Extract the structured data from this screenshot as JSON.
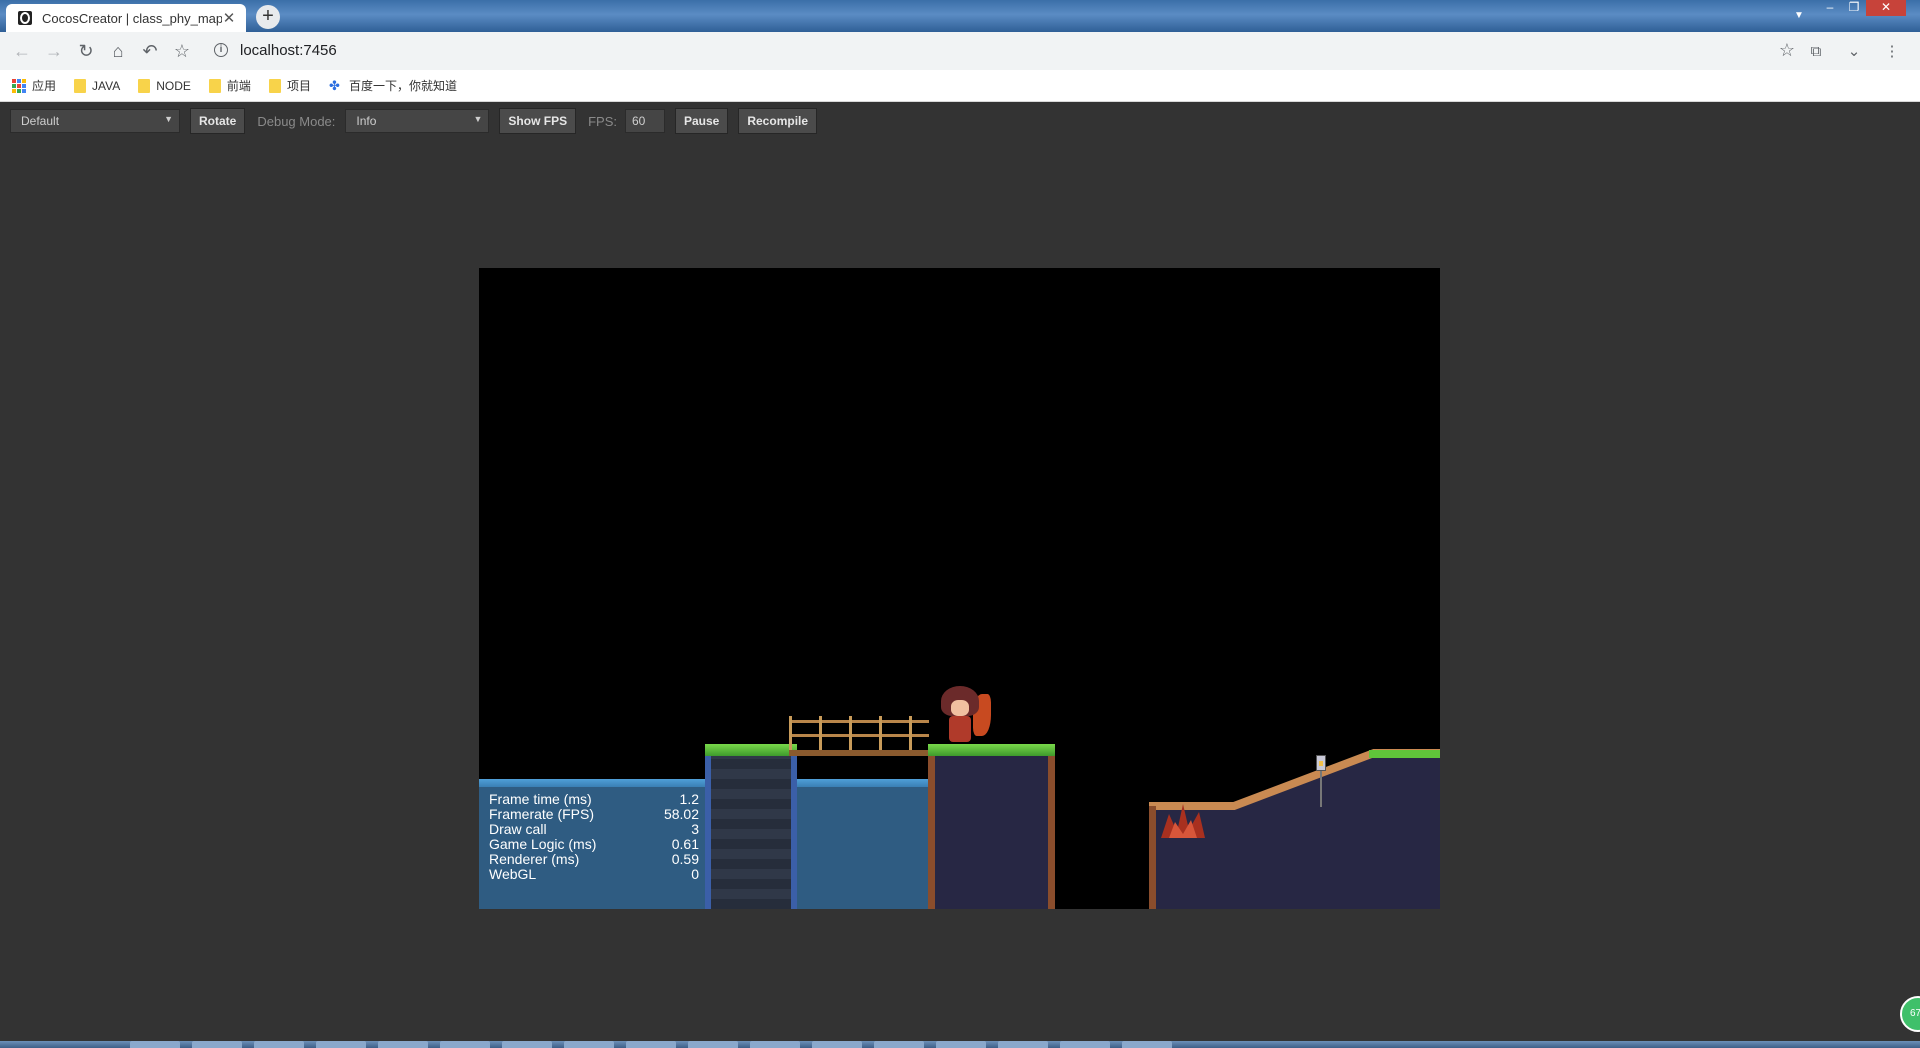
{
  "browser": {
    "tab_title": "CocosCreator | class_phy_map",
    "tab_close": "✕",
    "new_tab": "+",
    "url": "localhost:7456",
    "bookmarks": [
      {
        "label": "应用",
        "icon": "apps-icon"
      },
      {
        "label": "JAVA",
        "icon": "folder-icon"
      },
      {
        "label": "NODE",
        "icon": "folder-icon"
      },
      {
        "label": "前端",
        "icon": "folder-icon"
      },
      {
        "label": "项目",
        "icon": "folder-icon"
      },
      {
        "label": "百度一下，你就知道",
        "icon": "paw-icon"
      }
    ]
  },
  "preview_toolbar": {
    "device_select": "Default",
    "rotate_label": "Rotate",
    "debug_mode_label": "Debug Mode:",
    "debug_mode_value": "Info",
    "show_fps_label": "Show FPS",
    "fps_label": "FPS:",
    "fps_value": "60",
    "pause_label": "Pause",
    "recompile_label": "Recompile"
  },
  "stats": [
    {
      "label": "Frame time (ms)",
      "value": "1.2"
    },
    {
      "label": "Framerate (FPS)",
      "value": "58.02"
    },
    {
      "label": "Draw call",
      "value": "3"
    },
    {
      "label": "Game Logic (ms)",
      "value": "0.61"
    },
    {
      "label": "Renderer (ms)",
      "value": "0.59"
    },
    {
      "label": "WebGL",
      "value": "0"
    }
  ],
  "badge": "67",
  "colors": {
    "chrome_bg": "#333333",
    "canvas_bg": "#000000",
    "water": "#2f5c82",
    "grass": "#3e9a2c"
  }
}
